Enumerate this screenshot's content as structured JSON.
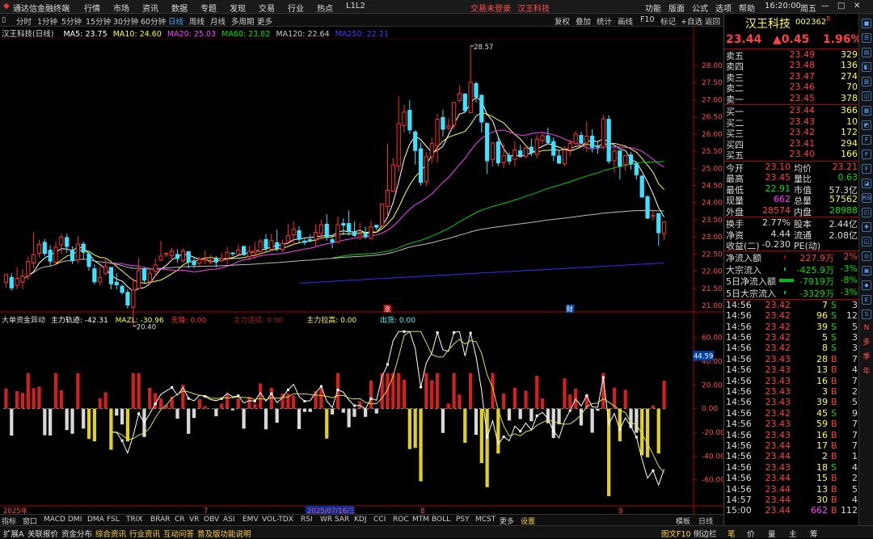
{
  "menu": {
    "app_title": "通达信金融终端",
    "items": [
      "行情",
      "市场",
      "资讯",
      "数据",
      "专题",
      "发现",
      "交易",
      "行业",
      "热点",
      "L1L2"
    ],
    "trade_status": "交易未登录",
    "stock_name": "汉王科技",
    "right_items": [
      "功能",
      "版面",
      "公式",
      "选项",
      "帮助"
    ],
    "clock": "16:20:00",
    "weekday": "周五"
  },
  "periods": [
    "分时",
    "1分钟",
    "5分钟",
    "15分钟",
    "30分钟",
    "60分钟",
    "日线",
    "周线",
    "月线",
    "多周期",
    "更多"
  ],
  "chart_tools": [
    "复权",
    "叠加",
    "统计",
    "画线",
    "F10",
    "标记",
    "+自选",
    "返回"
  ],
  "ma_legend": {
    "title": "汉王科技(日线)",
    "items": [
      {
        "label": "MA5: 23.75",
        "color": "#ffffff"
      },
      {
        "label": "MA10: 24.60",
        "color": "#ffff40"
      },
      {
        "label": "MA20: 25.03",
        "color": "#ff40ff"
      },
      {
        "label": "MA60: 23.82",
        "color": "#00e000"
      },
      {
        "label": "MA120: 22.64",
        "color": "#cccccc"
      },
      {
        "label": "MA250: 22.21",
        "color": "#4040ff"
      }
    ]
  },
  "price_axis": {
    "labels": [
      "28.00",
      "27.50",
      "27.00",
      "26.50",
      "26.00",
      "25.50",
      "25.00",
      "24.50",
      "24.00",
      "23.50",
      "23.00",
      "22.50",
      "22.00",
      "21.50",
      "21.00"
    ],
    "ymax": 28.0,
    "ymin": 21.0
  },
  "annotations": {
    "high": "28.57",
    "low": "20.40",
    "event_up": "涨",
    "event_fin": "财"
  },
  "indicator": {
    "name": "大单资金异动",
    "l1": "主力轨迹: -42.31",
    "l2": "MAZL: -30.96",
    "l3": "先锋: 0.00",
    "l4": "主力连续: 0.00",
    "l5": "主力拉高: 0.00",
    "l6": "出货: 0.00",
    "axis": [
      "60.00",
      "40.00",
      "20.00",
      "0.00",
      "-20.00",
      "-40.00",
      "-60.00"
    ],
    "ymax": 70,
    "ymin": -80,
    "current_label": "44.59"
  },
  "x_labels": {
    "start": "2025年",
    "m1": "7",
    "sel": "2025/07/16/三",
    "m2": "8",
    "m3": "9"
  },
  "bottom_tabs": [
    "指标",
    "窗口",
    "MACD",
    "DMI",
    "DMA",
    "FSL",
    "TRIX",
    "BRAR",
    "CR",
    "VR",
    "OBV",
    "ASI",
    "EMV",
    "VOL-TDX",
    "RSI",
    "WR",
    "SAR",
    "KDJ",
    "CCI",
    "ROC",
    "MTM",
    "BOLL",
    "PSY",
    "MCST",
    "更多",
    "设置"
  ],
  "bottom_right": [
    "模板",
    "日线"
  ],
  "status_tabs": [
    "扩展A",
    "关联报价",
    "资金分布",
    "综合资讯",
    "行业资讯",
    "互动问答",
    "普及版功能说明"
  ],
  "status_right": [
    "图文F10",
    "侧边栏",
    "笔",
    "价",
    "量",
    "主",
    "筹"
  ],
  "quote": {
    "name": "汉王科技",
    "code": "002362",
    "r": "R",
    "price": "23.44",
    "change": "▲0.45",
    "pct": "1.96%",
    "asks": [
      [
        "卖五",
        "23.49",
        "329"
      ],
      [
        "卖四",
        "23.48",
        "136"
      ],
      [
        "卖三",
        "23.47",
        "274"
      ],
      [
        "卖二",
        "23.46",
        "70"
      ],
      [
        "卖一",
        "23.45",
        "378"
      ]
    ],
    "bids": [
      [
        "买一",
        "23.44",
        "366"
      ],
      [
        "买二",
        "23.43",
        "10"
      ],
      [
        "买三",
        "23.42",
        "172"
      ],
      [
        "买四",
        "23.41",
        "294"
      ],
      [
        "买五",
        "23.40",
        "166"
      ]
    ],
    "stats": [
      [
        "今开",
        "23.10",
        "均价",
        "23.21"
      ],
      [
        "最高",
        "23.45",
        "量比",
        "0.63"
      ],
      [
        "最低",
        "22.91",
        "市值",
        "57.3亿"
      ],
      [
        "现量",
        "662",
        "总量",
        "57562"
      ],
      [
        "外盘",
        "28574",
        "内盘",
        "28988"
      ],
      [
        "换手",
        "2.77%",
        "股本",
        "2.44亿"
      ],
      [
        "净资",
        "4.44",
        "流通",
        "2.08亿"
      ],
      [
        "收益(二)",
        "-0.230",
        "PE(动)",
        ""
      ]
    ],
    "flows": [
      [
        "净流入额",
        "227.9万",
        "2%"
      ],
      [
        "大宗流入",
        "-425.9万",
        "-3%"
      ],
      [
        "5日净流入额",
        "-7919万",
        "-8%"
      ],
      [
        "5日大宗流入",
        "-3329万",
        "-3%"
      ]
    ],
    "ticks": [
      [
        "14:56",
        "23.42",
        "7",
        "S",
        "3"
      ],
      [
        "14:56",
        "23.42",
        "96",
        "S",
        "12"
      ],
      [
        "14:56",
        "23.42",
        "39",
        "S",
        "5"
      ],
      [
        "14:56",
        "23.42",
        "5",
        "S",
        "3"
      ],
      [
        "14:56",
        "23.42",
        "8",
        "S",
        "3"
      ],
      [
        "14:56",
        "23.43",
        "28",
        "B",
        "7"
      ],
      [
        "14:56",
        "23.43",
        "13",
        "B",
        "4"
      ],
      [
        "14:56",
        "23.43",
        "16",
        "B",
        "7"
      ],
      [
        "14:56",
        "23.43",
        "3",
        "B",
        "2"
      ],
      [
        "14:56",
        "23.43",
        "39",
        "B",
        "5"
      ],
      [
        "14:56",
        "23.42",
        "45",
        "S",
        "9"
      ],
      [
        "14:56",
        "23.43",
        "59",
        "B",
        "7"
      ],
      [
        "14:56",
        "23.43",
        "16",
        "B",
        "7"
      ],
      [
        "14:56",
        "23.44",
        "17",
        "B",
        "7"
      ],
      [
        "14:56",
        "23.44",
        "2",
        "B",
        "1"
      ],
      [
        "14:56",
        "23.43",
        "18",
        "S",
        "4"
      ],
      [
        "14:56",
        "23.44",
        "15",
        "B",
        "2"
      ],
      [
        "14:56",
        "23.44",
        "13",
        "B",
        "5"
      ],
      [
        "14:57",
        "23.44",
        "30",
        "B",
        "4"
      ],
      [
        "15:00",
        "23.44",
        "662",
        "B",
        "112"
      ]
    ]
  },
  "vtools": [
    "■",
    "☰",
    "▤",
    "◧",
    "▥",
    "◫",
    "▦",
    "◩",
    "F",
    "F",
    "F",
    "◪",
    "RSI",
    "◰",
    "✚",
    "◱",
    "◎",
    "▣",
    "◆",
    "E",
    "S",
    "N",
    "多",
    "季",
    "年"
  ],
  "chart_data": {
    "type": "candlestick",
    "candles": [
      [
        21.67,
        21.9,
        21.52,
        21.92
      ],
      [
        21.82,
        21.51,
        21.43,
        21.94
      ],
      [
        21.59,
        21.79,
        21.48,
        22.11
      ],
      [
        21.68,
        21.86,
        21.47,
        22.05
      ],
      [
        21.87,
        22.28,
        21.76,
        22.42
      ],
      [
        22.24,
        22.48,
        22.08,
        23.15
      ],
      [
        22.52,
        22.78,
        22.41,
        22.92
      ],
      [
        22.84,
        22.52,
        22.43,
        22.94
      ],
      [
        22.61,
        22.29,
        22.16,
        22.75
      ],
      [
        22.26,
        22.7,
        22.22,
        22.85
      ],
      [
        22.77,
        22.99,
        22.49,
        23.09
      ],
      [
        22.98,
        22.72,
        22.53,
        23.09
      ],
      [
        22.61,
        22.31,
        22.21,
        22.73
      ],
      [
        22.33,
        22.79,
        22.23,
        23.02
      ],
      [
        22.79,
        22.55,
        22.33,
        22.86
      ],
      [
        22.5,
        22.14,
        22.01,
        22.57
      ],
      [
        22.07,
        21.69,
        21.61,
        22.2
      ],
      [
        21.69,
        21.81,
        21.58,
        22.12
      ],
      [
        21.94,
        22.13,
        21.88,
        22.35
      ],
      [
        22.11,
        21.63,
        21.47,
        22.12
      ],
      [
        21.68,
        21.6,
        21.47,
        21.95
      ],
      [
        21.56,
        21.38,
        21.32,
        21.61
      ],
      [
        21.38,
        21.01,
        20.91,
        21.47
      ],
      [
        20.95,
        21.45,
        20.4,
        21.8
      ],
      [
        21.5,
        22.02,
        21.48,
        22.39
      ],
      [
        22.07,
        21.74,
        21.66,
        22.12
      ],
      [
        21.7,
        21.94,
        21.62,
        22.08
      ],
      [
        22.0,
        22.18,
        21.82,
        22.37
      ],
      [
        22.32,
        22.44,
        22.29,
        22.89
      ],
      [
        22.48,
        22.52,
        22.41,
        22.55
      ],
      [
        22.45,
        22.59,
        22.32,
        22.68
      ],
      [
        22.49,
        22.37,
        22.25,
        22.64
      ],
      [
        22.31,
        22.59,
        22.25,
        22.67
      ],
      [
        22.57,
        22.27,
        22.08,
        22.58
      ],
      [
        22.3,
        22.19,
        22.09,
        22.43
      ],
      [
        22.24,
        22.35,
        22.1,
        22.41
      ],
      [
        22.32,
        22.35,
        22.2,
        22.6
      ],
      [
        22.29,
        22.29,
        22.2,
        22.47
      ],
      [
        22.36,
        22.27,
        22.1,
        22.44
      ],
      [
        22.3,
        22.36,
        22.27,
        22.53
      ],
      [
        22.38,
        22.55,
        22.2,
        22.71
      ],
      [
        22.53,
        22.51,
        22.44,
        22.56
      ],
      [
        22.5,
        22.62,
        22.49,
        22.78
      ],
      [
        22.72,
        22.48,
        22.45,
        22.75
      ],
      [
        22.43,
        22.57,
        22.32,
        22.74
      ],
      [
        22.54,
        22.6,
        22.43,
        22.85
      ],
      [
        22.57,
        22.87,
        22.48,
        22.94
      ],
      [
        22.92,
        22.67,
        22.56,
        23.08
      ],
      [
        22.64,
        22.89,
        22.61,
        23.1
      ],
      [
        22.83,
        22.66,
        22.57,
        23.21
      ],
      [
        22.63,
        22.81,
        22.56,
        22.91
      ],
      [
        22.86,
        23.04,
        22.78,
        23.38
      ],
      [
        23.06,
        23.22,
        22.76,
        23.46
      ],
      [
        23.18,
        22.93,
        22.82,
        23.31
      ],
      [
        22.88,
        22.84,
        22.76,
        22.94
      ],
      [
        22.92,
        22.88,
        22.84,
        23.07
      ],
      [
        22.92,
        23.13,
        22.73,
        23.37
      ],
      [
        23.1,
        23.35,
        22.92,
        23.51
      ],
      [
        23.37,
        23.0,
        22.89,
        23.66
      ],
      [
        22.92,
        22.85,
        22.67,
        23.02
      ],
      [
        22.84,
        23.36,
        22.81,
        23.59
      ],
      [
        23.39,
        23.34,
        23.05,
        23.54
      ],
      [
        23.39,
        23.16,
        23.04,
        23.77
      ],
      [
        23.14,
        23.04,
        23.0,
        23.45
      ],
      [
        22.98,
        23.07,
        22.91,
        23.41
      ],
      [
        23.1,
        23.0,
        22.94,
        23.3
      ],
      [
        22.95,
        23.29,
        22.92,
        23.47
      ],
      [
        23.34,
        23.28,
        23.2,
        23.32
      ],
      [
        23.32,
        23.96,
        23.28,
        23.96
      ],
      [
        23.89,
        24.36,
        23.58,
        25.72
      ],
      [
        24.33,
        25.1,
        24.3,
        25.3
      ],
      [
        25.07,
        26.3,
        24.9,
        27.1
      ],
      [
        26.25,
        26.65,
        26.04,
        26.85
      ],
      [
        26.69,
        26.12,
        26.0,
        26.99
      ],
      [
        26.06,
        25.52,
        25.11,
        26.11
      ],
      [
        25.57,
        24.59,
        24.5,
        25.75
      ],
      [
        24.61,
        25.34,
        24.48,
        25.48
      ],
      [
        25.34,
        25.72,
        25.14,
        25.9
      ],
      [
        25.66,
        26.43,
        25.17,
        26.59
      ],
      [
        26.48,
        26.14,
        25.92,
        26.71
      ],
      [
        26.17,
        26.24,
        26.1,
        26.45
      ],
      [
        26.26,
        26.92,
        26.15,
        26.93
      ],
      [
        26.98,
        27.18,
        26.92,
        27.42
      ],
      [
        27.17,
        26.68,
        26.65,
        27.17
      ],
      [
        26.62,
        27.51,
        26.61,
        28.57
      ],
      [
        27.47,
        27.09,
        26.92,
        27.53
      ],
      [
        27.13,
        26.35,
        26.05,
        27.16
      ],
      [
        26.31,
        25.22,
        24.84,
        26.34
      ],
      [
        25.25,
        25.74,
        25.05,
        25.77
      ],
      [
        25.77,
        25.16,
        25.07,
        25.95
      ],
      [
        25.17,
        25.37,
        25.0,
        25.74
      ],
      [
        25.37,
        25.21,
        25.11,
        25.46
      ],
      [
        25.26,
        25.54,
        25.07,
        25.8
      ],
      [
        25.51,
        25.37,
        25.36,
        25.69
      ],
      [
        25.35,
        25.59,
        25.3,
        25.61
      ],
      [
        25.62,
        25.45,
        25.36,
        25.87
      ],
      [
        25.41,
        25.85,
        25.29,
        25.97
      ],
      [
        25.81,
        25.95,
        25.7,
        26.07
      ],
      [
        25.95,
        25.75,
        25.7,
        26.19
      ],
      [
        25.78,
        25.38,
        25.21,
        25.9
      ],
      [
        25.36,
        25.15,
        25.13,
        25.52
      ],
      [
        25.13,
        25.53,
        25.06,
        25.65
      ],
      [
        25.54,
        25.73,
        25.36,
        25.84
      ],
      [
        25.73,
        26.0,
        25.66,
        26.09
      ],
      [
        25.96,
        25.73,
        25.69,
        26.06
      ],
      [
        25.74,
        25.94,
        25.48,
        26.37
      ],
      [
        25.94,
        25.61,
        25.46,
        26.14
      ],
      [
        25.65,
        25.62,
        25.42,
        25.79
      ],
      [
        25.62,
        26.44,
        25.54,
        26.56
      ],
      [
        26.43,
        25.21,
        25.13,
        26.55
      ],
      [
        25.22,
        25.5,
        24.87,
        25.6
      ],
      [
        25.51,
        25.07,
        24.68,
        25.51
      ],
      [
        25.12,
        25.37,
        24.93,
        25.4
      ],
      [
        25.39,
        25.13,
        24.96,
        25.47
      ],
      [
        25.13,
        24.81,
        24.67,
        25.17
      ],
      [
        24.77,
        24.16,
        24.16,
        24.82
      ],
      [
        24.17,
        23.55,
        23.52,
        24.22
      ],
      [
        23.59,
        23.63,
        23.48,
        23.8
      ],
      [
        23.68,
        23.12,
        22.74,
        23.7
      ],
      [
        23.1,
        23.44,
        22.91,
        23.45
      ]
    ],
    "zl": [
      -8.3,
      -6.2,
      -4.5,
      -3.1,
      -1.7,
      -0.2,
      1.1,
      2.6,
      3.5,
      4.2,
      4.5,
      4.4,
      3.9,
      3.1,
      2.5,
      1.9,
      1.2,
      0.5,
      -0.5,
      -2.8,
      -1.9,
      -1.3,
      -0.9,
      -0.5,
      -0.1,
      -0.7,
      -2.1,
      -4.0,
      -2.6,
      -1.6,
      -0.4,
      0.7,
      1.7,
      2.1,
      2.2,
      1.9,
      1.3,
      0.5,
      -0.5,
      -1.7,
      -2.0,
      -1.5,
      -0.8,
      -0.2,
      0.2,
      0.5,
      0.7,
      0.7,
      0.5,
      0.3,
      0.1,
      -0.3,
      -0.9,
      -2.5,
      -4.6,
      -6.8,
      -9.2,
      -11.9,
      -15.3,
      -18.8,
      -21.4,
      -23.1,
      -24.2,
      -25.4,
      -26.6,
      -27.7,
      -29.0,
      -30.3,
      -31.6,
      -33.0,
      -34.4,
      -35.6,
      -36.5,
      -37.2,
      -38.0,
      -38.7,
      -39.6,
      -40.4,
      -41.6,
      -42.7,
      -43.1,
      -43.5,
      -43.6,
      -43.5,
      -43.4,
      -43.3,
      -43.1,
      -42.9,
      -42.7,
      -42.5,
      -42.3,
      -42.3,
      -42.3,
      -42.3,
      -42.3,
      -42.3,
      -42.3,
      -42.3,
      -42.3,
      -42.3,
      -42.3,
      -42.3,
      -42.3,
      -42.3,
      -42.3,
      -42.3,
      -42.3,
      -42.3,
      -42.3,
      -42.3,
      -42.3,
      -42.3,
      -42.3,
      -42.3,
      -42.3,
      -42.3,
      -42.3,
      -42.3,
      -42.3,
      -42.3,
      -42.3
    ]
  }
}
